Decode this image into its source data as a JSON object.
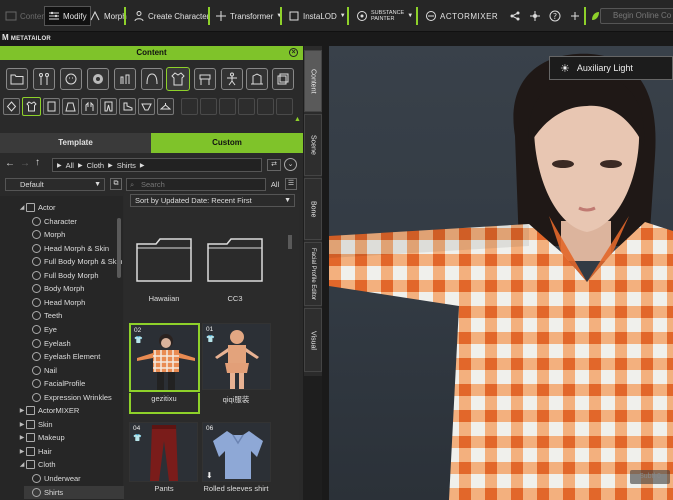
{
  "toolbar": {
    "content": "Content",
    "modify": "Modify",
    "morph": "Morph",
    "create_character": "Create Character",
    "transformer": "Transformer",
    "instalod": "InstaLOD",
    "substance_painter_top": "SUBSTANCE",
    "substance_painter_bottom": "PAINTER",
    "actormixer": "ACTORMIXER",
    "search_placeholder": "Begin Online Co"
  },
  "brand": "METATAILOR",
  "panel": {
    "title": "Content",
    "tabs": {
      "template": "Template",
      "custom": "Custom"
    },
    "breadcrumb": [
      "All",
      "Cloth",
      "Shirts"
    ],
    "filter_default": "Default",
    "search_placeholder": "Search",
    "search_scope": "All",
    "sort_label": "Sort by Updated Date: Recent First"
  },
  "tree": [
    {
      "label": "Actor",
      "level": 1,
      "expanded": true
    },
    {
      "label": "Character",
      "level": 2
    },
    {
      "label": "Morph",
      "level": 2
    },
    {
      "label": "Head Morph & Skin",
      "level": 2
    },
    {
      "label": "Full Body Morph & Skin",
      "level": 2
    },
    {
      "label": "Full Body Morph",
      "level": 2
    },
    {
      "label": "Body Morph",
      "level": 2
    },
    {
      "label": "Head Morph",
      "level": 2
    },
    {
      "label": "Teeth",
      "level": 2
    },
    {
      "label": "Eye",
      "level": 2
    },
    {
      "label": "Eyelash",
      "level": 2
    },
    {
      "label": "Eyelash Element",
      "level": 2
    },
    {
      "label": "Nail",
      "level": 2
    },
    {
      "label": "FacialProfile",
      "level": 2
    },
    {
      "label": "Expression Wrinkles",
      "level": 2
    },
    {
      "label": "ActorMIXER",
      "level": 1
    },
    {
      "label": "Skin",
      "level": 1
    },
    {
      "label": "Makeup",
      "level": 1
    },
    {
      "label": "Hair",
      "level": 1
    },
    {
      "label": "Cloth",
      "level": 1,
      "expanded": true
    },
    {
      "label": "Underwear",
      "level": 2
    },
    {
      "label": "Shirts",
      "level": 2,
      "selected": true
    }
  ],
  "folders": [
    {
      "label": "Hawaiian"
    },
    {
      "label": "CC3"
    }
  ],
  "items": [
    {
      "num": "02",
      "label": "gezitixu",
      "selected": true
    },
    {
      "num": "01",
      "label": "qiqi服装"
    },
    {
      "num": "04",
      "label": "Pants"
    },
    {
      "num": "06",
      "label": "Rolled sleeves shirt"
    }
  ],
  "vtabs": [
    "Content",
    "Scene",
    "Bone",
    "Facial Profile Editor",
    "Visual"
  ],
  "viewport": {
    "aux_light": "Auxiliary Light",
    "badge": "Subtl 0"
  },
  "colors": {
    "accent": "#7fc32a"
  }
}
